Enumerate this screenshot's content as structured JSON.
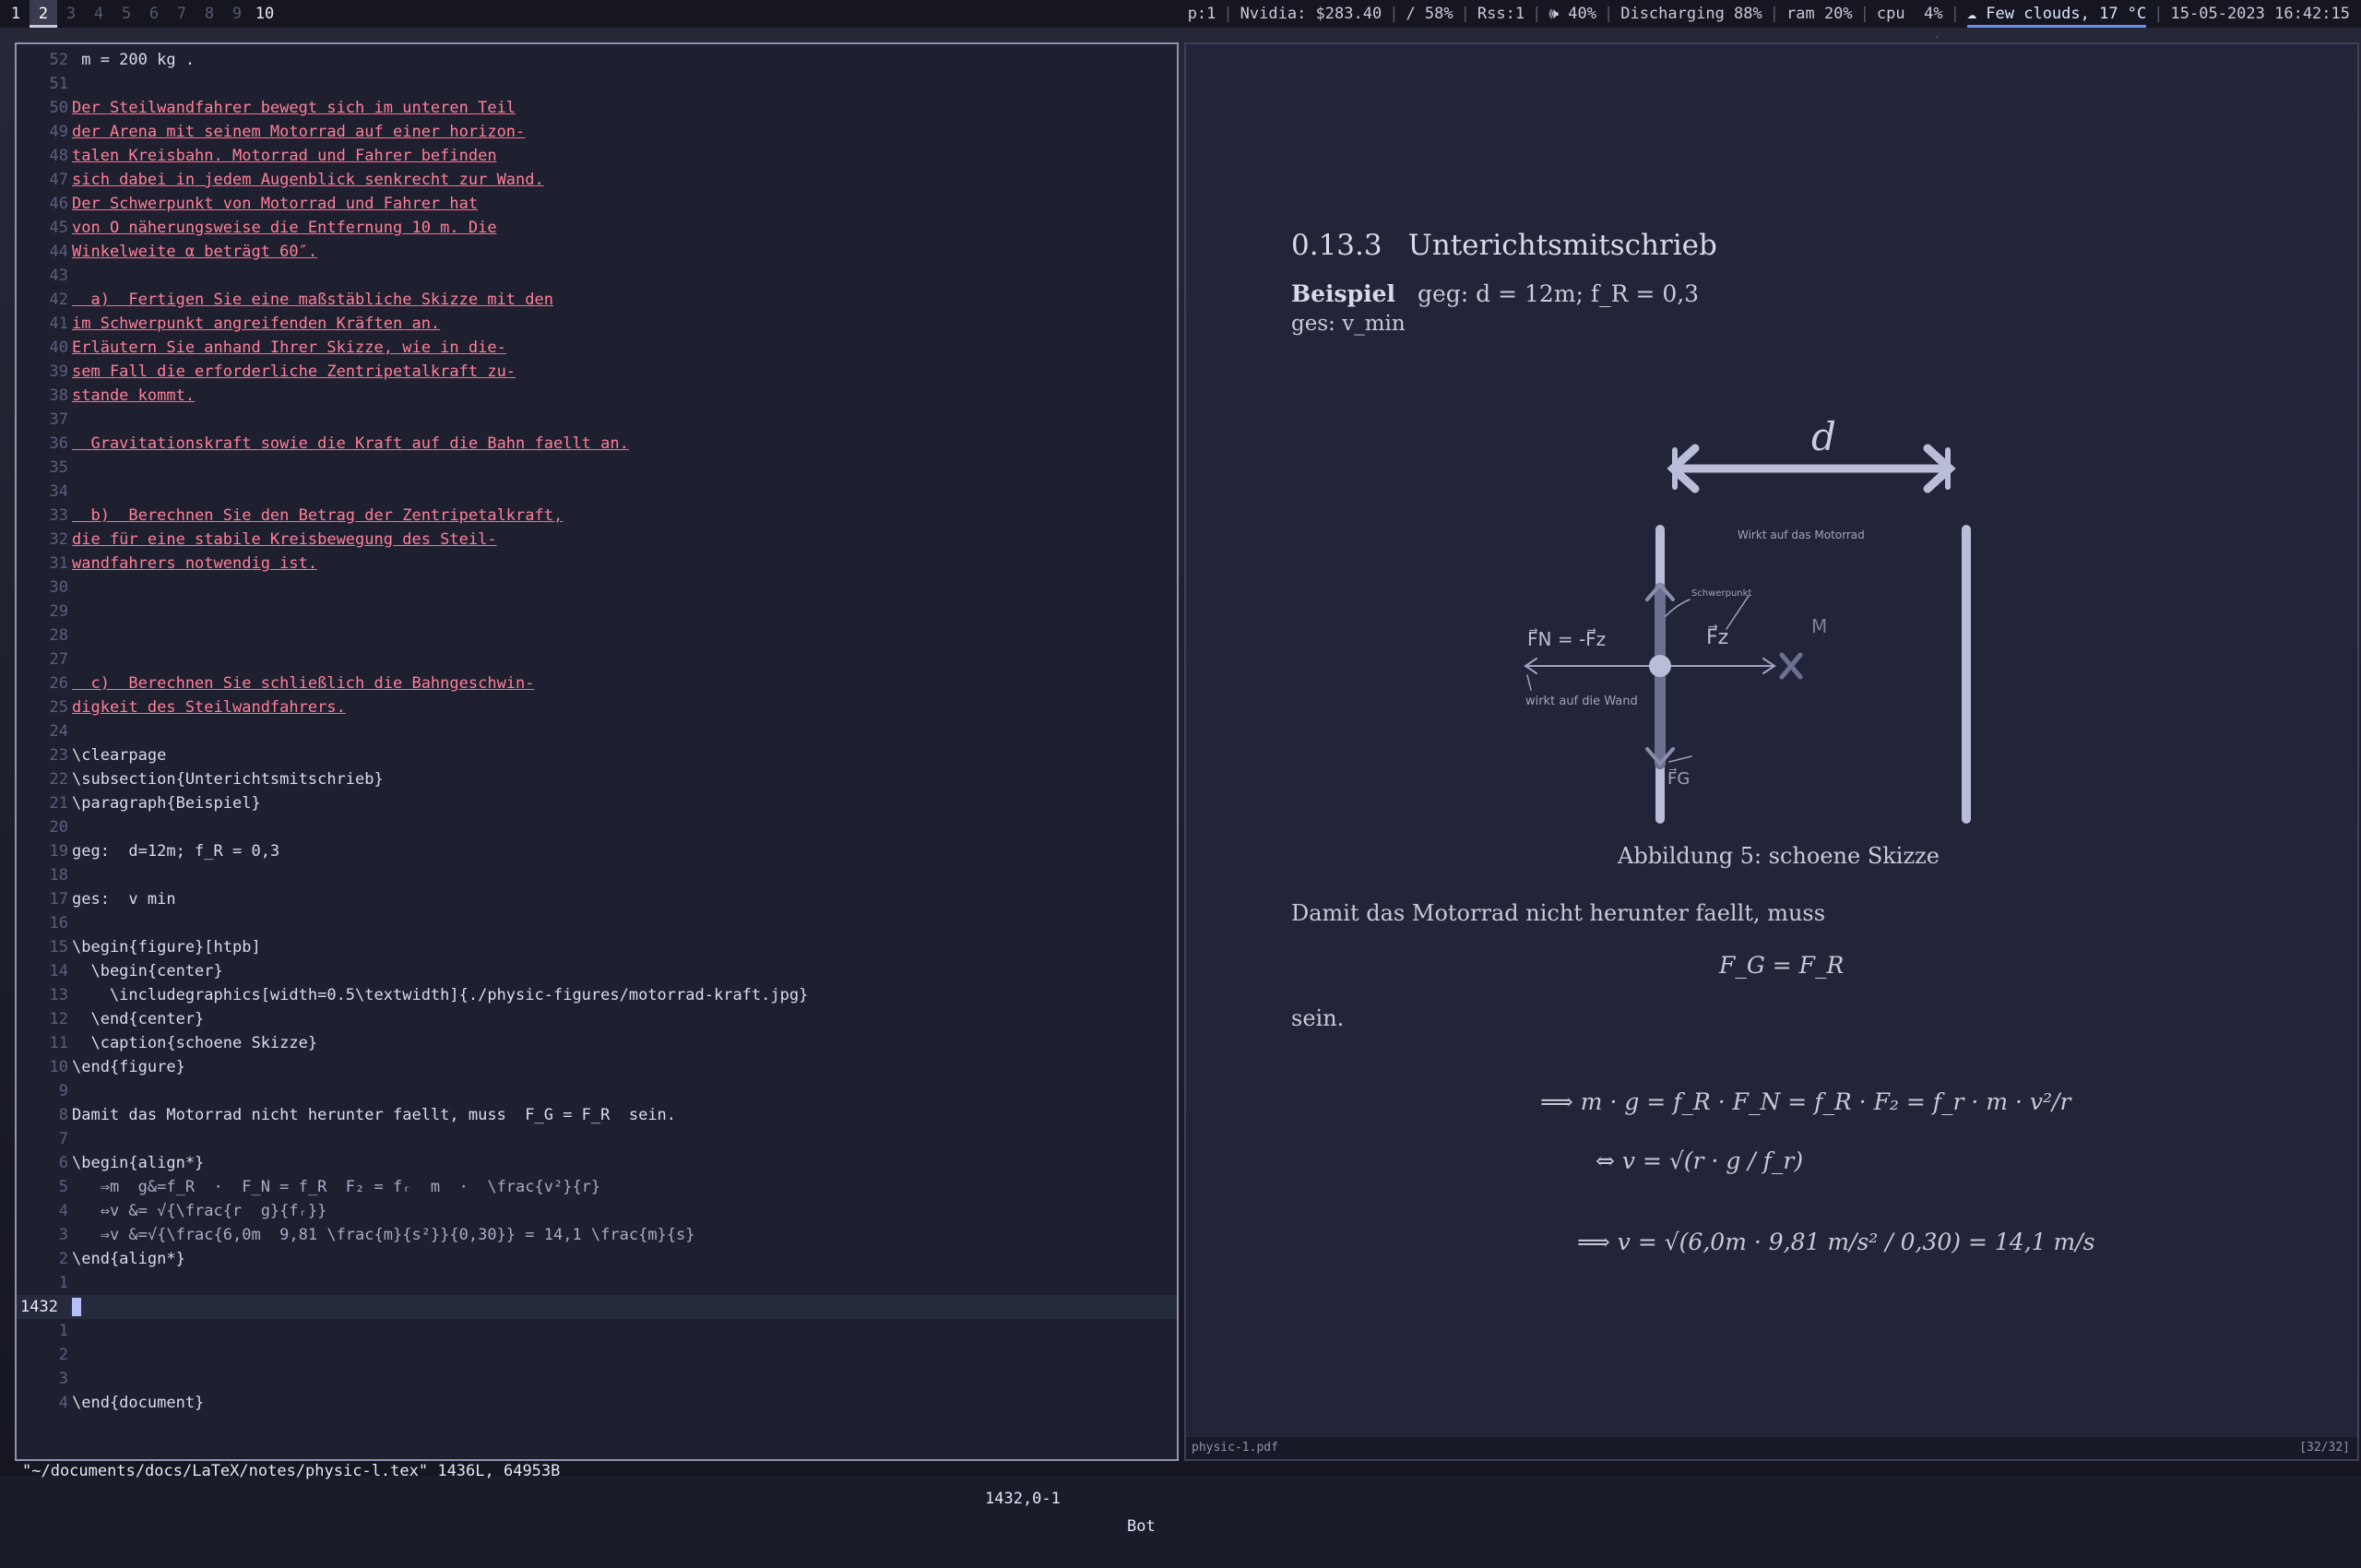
{
  "topbar": {
    "workspaces": [
      "1",
      "2",
      "3",
      "4",
      "5",
      "6",
      "7",
      "8",
      "9",
      "10"
    ],
    "current_workspace": "2",
    "status": [
      "p:1",
      "Nvidia: $283.40",
      "/ 58%",
      "Rss:1",
      "🕪 40%",
      "Discharging 88%",
      "ram 20%",
      "cpu  4%",
      "☁ Few clouds, 17 °C",
      "15-05-2023 16:42:15"
    ]
  },
  "editor": {
    "lines": [
      {
        "n": "52",
        "t": " m = 200 kg .",
        "s": "tex"
      },
      {
        "n": "51",
        "t": "",
        "s": ""
      },
      {
        "n": "50",
        "t": "Der Steilwandfahrer bewegt sich im unteren Teil",
        "s": "ul"
      },
      {
        "n": "49",
        "t": "der Arena mit seinem Motorrad auf einer horizon-",
        "s": "ul"
      },
      {
        "n": "48",
        "t": "talen Kreisbahn. Motorrad und Fahrer befinden",
        "s": "ul"
      },
      {
        "n": "47",
        "t": "sich dabei in jedem Augenblick senkrecht zur Wand.",
        "s": "ul"
      },
      {
        "n": "46",
        "t": "Der Schwerpunkt von Motorrad und Fahrer hat",
        "s": "ul"
      },
      {
        "n": "45",
        "t": "von O näherungsweise die Entfernung 10 m. Die",
        "s": "ul"
      },
      {
        "n": "44",
        "t": "Winkelweite α beträgt 60″.",
        "s": "ul"
      },
      {
        "n": "43",
        "t": "",
        "s": ""
      },
      {
        "n": "42",
        "t": "  a)  Fertigen Sie eine maßstäbliche Skizze mit den",
        "s": "ul"
      },
      {
        "n": "41",
        "t": "im Schwerpunkt angreifenden Kräften an.",
        "s": "ul"
      },
      {
        "n": "40",
        "t": "Erläutern Sie anhand Ihrer Skizze, wie in die-",
        "s": "ul"
      },
      {
        "n": "39",
        "t": "sem Fall die erforderliche Zentripetalkraft zu-",
        "s": "ul"
      },
      {
        "n": "38",
        "t": "stande kommt.",
        "s": "ul"
      },
      {
        "n": "37",
        "t": "",
        "s": ""
      },
      {
        "n": "36",
        "t": "  Gravitationskraft sowie die Kraft auf die Bahn faellt an.",
        "s": "ul"
      },
      {
        "n": "35",
        "t": "",
        "s": ""
      },
      {
        "n": "34",
        "t": "",
        "s": ""
      },
      {
        "n": "33",
        "t": "  b)  Berechnen Sie den Betrag der Zentripetalkraft,",
        "s": "ul"
      },
      {
        "n": "32",
        "t": "die für eine stabile Kreisbewegung des Steil-",
        "s": "ul"
      },
      {
        "n": "31",
        "t": "wandfahrers notwendig ist.",
        "s": "ul"
      },
      {
        "n": "30",
        "t": "",
        "s": ""
      },
      {
        "n": "29",
        "t": "",
        "s": ""
      },
      {
        "n": "28",
        "t": "",
        "s": ""
      },
      {
        "n": "27",
        "t": "",
        "s": ""
      },
      {
        "n": "26",
        "t": "  c)  Berechnen Sie schließlich die Bahngeschwin-",
        "s": "ul"
      },
      {
        "n": "25",
        "t": "digkeit des Steilwandfahrers.",
        "s": "ul"
      },
      {
        "n": "24",
        "t": "",
        "s": ""
      },
      {
        "n": "23",
        "t": "\\clearpage",
        "s": "tex"
      },
      {
        "n": "22",
        "t": "\\subsection{Unterichtsmitschrieb}",
        "s": "tex"
      },
      {
        "n": "21",
        "t": "\\paragraph{Beispiel}",
        "s": "tex"
      },
      {
        "n": "20",
        "t": "",
        "s": ""
      },
      {
        "n": "19",
        "t": "geg:  d=12m; f_R = 0,3",
        "s": "tex"
      },
      {
        "n": "18",
        "t": "",
        "s": ""
      },
      {
        "n": "17",
        "t": "ges:  v min",
        "s": "tex"
      },
      {
        "n": "16",
        "t": "",
        "s": ""
      },
      {
        "n": "15",
        "t": "\\begin{figure}[htpb]",
        "s": "tex"
      },
      {
        "n": "14",
        "t": "  \\begin{center}",
        "s": "tex"
      },
      {
        "n": "13",
        "t": "    \\includegraphics[width=0.5\\textwidth]{./physic-figures/motorrad-kraft.jpg}",
        "s": "tex"
      },
      {
        "n": "12",
        "t": "  \\end{center}",
        "s": "tex"
      },
      {
        "n": "11",
        "t": "  \\caption{schoene Skizze}",
        "s": "tex"
      },
      {
        "n": "10",
        "t": "\\end{figure}",
        "s": "tex"
      },
      {
        "n": "9",
        "t": "",
        "s": ""
      },
      {
        "n": "8",
        "t": "Damit das Motorrad nicht herunter faellt, muss  F_G = F_R  sein.",
        "s": "tex"
      },
      {
        "n": "7",
        "t": "",
        "s": ""
      },
      {
        "n": "6",
        "t": "\\begin{align*}",
        "s": "tex"
      },
      {
        "n": "5",
        "t": "   ⇒m  g&=f_R  ·  F_N = f_R  F₂ = fᵣ  m  ·  \\frac{v²}{r}",
        "s": "dim"
      },
      {
        "n": "4",
        "t": "   ⇔v &= √{\\frac{r  g}{fᵣ}}",
        "s": "dim"
      },
      {
        "n": "3",
        "t": "   ⇒v &=√{\\frac{6,0m  9,81 \\frac{m}{s²}}{0,30}} = 14,1 \\frac{m}{s}",
        "s": "dim"
      },
      {
        "n": "2",
        "t": "\\end{align*}",
        "s": "tex"
      },
      {
        "n": "1",
        "t": "",
        "s": ""
      },
      {
        "n": "1432",
        "t": "",
        "s": "cur"
      },
      {
        "n": "1",
        "t": "",
        "s": ""
      },
      {
        "n": "2",
        "t": "",
        "s": ""
      },
      {
        "n": "3",
        "t": "",
        "s": ""
      },
      {
        "n": "4",
        "t": "\\end{document}",
        "s": "tex"
      }
    ],
    "cmdline_file": "\"~/documents/docs/LaTeX/notes/physic-l.tex\" 1436L, 64953B",
    "cmdline_pos": "1432,0-1",
    "cmdline_scroll": "Bot"
  },
  "pdf": {
    "section_number": "0.13.3",
    "section_title": "Unterichtsmitschrieb",
    "example_label": "Beispiel",
    "given": "geg: d = 12m; f_R = 0,3",
    "sought": "ges: v_min",
    "figure_labels": {
      "d": "d",
      "wirkt_motorrad": "Wirkt auf das Motorrad",
      "schwerpunkt": "Schwerpunkt",
      "fn_eq": "F⃗N = -F⃗z",
      "fz": "F⃗z",
      "m": "M",
      "wirkt_wand": "wirkt auf die Wand",
      "fg": "F⃗G"
    },
    "caption": "Abbildung 5: schoene Skizze",
    "sentence": "Damit das Motorrad nicht herunter faellt, muss",
    "eq_center": "F_G = F_R",
    "sein": "sein.",
    "eq_line1": "⟹  m · g = f_R · F_N = f_R · F₂ = f_r · m · v²/r",
    "eq_line2": "⇔ v = √(r · g / f_r)",
    "eq_line3": "⟹  v = √(6,0m · 9,81 m/s² / 0,30) = 14,1 m/s",
    "filename": "physic-1.pdf",
    "page": "[32/32]"
  }
}
